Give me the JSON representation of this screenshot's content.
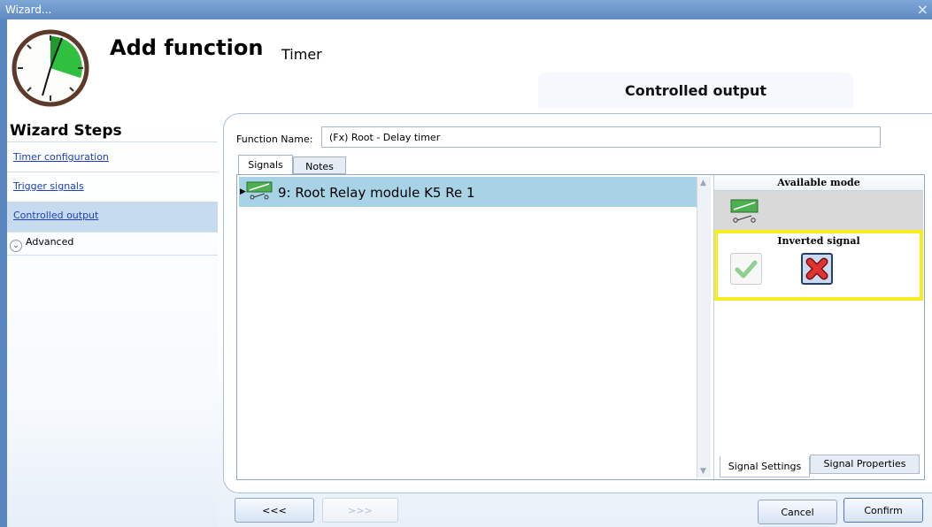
{
  "window": {
    "title": "Wizard...",
    "close_glyph": "×"
  },
  "header": {
    "title": "Add function",
    "subtitle": "Timer",
    "step_banner": "Controlled output"
  },
  "wizard_steps": {
    "heading": "Wizard Steps",
    "items": [
      {
        "label": "Timer configuration"
      },
      {
        "label": "Trigger signals"
      },
      {
        "label": "Controlled output",
        "active": true
      }
    ],
    "advanced": {
      "label": "Advanced",
      "expander_glyph": "⌄"
    }
  },
  "function_name": {
    "label": "Function Name:",
    "value": "(Fx) Root - Delay timer"
  },
  "tabs": {
    "signals": "Signals",
    "notes": "Notes"
  },
  "signals": [
    {
      "label": "9: Root Relay module K5 Re 1",
      "icon": "relay-icon",
      "selected": true
    }
  ],
  "right_pane": {
    "available_mode": "Available mode",
    "inverted_signal": {
      "label": "Inverted signal",
      "selected": "no"
    },
    "tabs": {
      "settings": "Signal Settings",
      "properties": "Signal Properties"
    }
  },
  "buttons": {
    "back": "<<<",
    "next": ">>>",
    "cancel": "Cancel",
    "confirm": "Confirm"
  },
  "colors": {
    "highlight_border": "#f5ec22",
    "selected_row": "#a8d3e6",
    "link": "#1a3fbf",
    "clock_fill": "#1f9a2e"
  }
}
